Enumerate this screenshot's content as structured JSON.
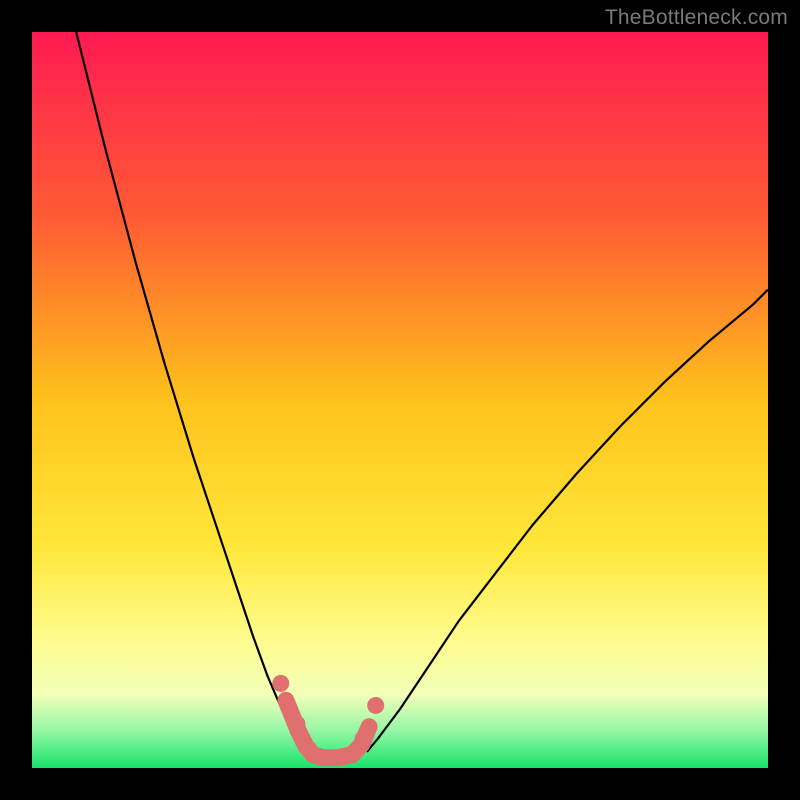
{
  "watermark": "TheBottleneck.com",
  "chart_data": {
    "type": "line",
    "title": "",
    "xlabel": "",
    "ylabel": "",
    "xlim": [
      0,
      100
    ],
    "ylim": [
      0,
      100
    ],
    "grid": false,
    "legend": false,
    "background_gradient": {
      "stops": [
        {
          "pos": 0.0,
          "color": "#ff1a52"
        },
        {
          "pos": 0.25,
          "color": "#ff5a34"
        },
        {
          "pos": 0.5,
          "color": "#ffc21c"
        },
        {
          "pos": 0.7,
          "color": "#ffe73a"
        },
        {
          "pos": 0.82,
          "color": "#fffb8a"
        },
        {
          "pos": 0.9,
          "color": "#f3ffb8"
        },
        {
          "pos": 0.95,
          "color": "#93f7a5"
        },
        {
          "pos": 1.0,
          "color": "#17e36a"
        }
      ]
    },
    "series": [
      {
        "name": "left-curve",
        "stroke": "#000000",
        "stroke_width": 2.2,
        "x": [
          6,
          10,
          14,
          18,
          22,
          26,
          28,
          30,
          32,
          33.5,
          35,
          36.5,
          37.5
        ],
        "y": [
          100,
          84,
          69,
          55,
          42,
          30,
          24,
          18,
          12.5,
          9,
          6,
          3.5,
          2.2
        ]
      },
      {
        "name": "right-curve",
        "stroke": "#000000",
        "stroke_width": 2.2,
        "x": [
          45.5,
          47,
          50,
          54,
          58,
          63,
          68,
          74,
          80,
          86,
          92,
          98,
          100
        ],
        "y": [
          2.2,
          4,
          8,
          14,
          20,
          26.5,
          33,
          40,
          46.5,
          52.5,
          58,
          63,
          65
        ]
      },
      {
        "name": "bottom-accent",
        "stroke": "#e07070",
        "stroke_width": 17,
        "linecap": "round",
        "x": [
          34.5,
          36.2,
          37.2,
          38.2,
          39.5,
          41.5,
          43.5,
          44.8,
          45.8
        ],
        "y": [
          9.2,
          5.0,
          3.0,
          1.8,
          1.4,
          1.4,
          1.8,
          3.2,
          5.6
        ]
      }
    ],
    "markers": [
      {
        "name": "accent-dot-left-upper",
        "x": 33.8,
        "y": 11.5,
        "r": 8.5,
        "color": "#e07070"
      },
      {
        "name": "accent-dot-left-mid",
        "x": 36.0,
        "y": 6.0,
        "r": 8.5,
        "color": "#e07070"
      },
      {
        "name": "accent-dot-right-upper",
        "x": 46.7,
        "y": 8.5,
        "r": 8.5,
        "color": "#e07070"
      },
      {
        "name": "accent-dot-right-mid",
        "x": 45.0,
        "y": 4.0,
        "r": 8.5,
        "color": "#e07070"
      }
    ]
  }
}
